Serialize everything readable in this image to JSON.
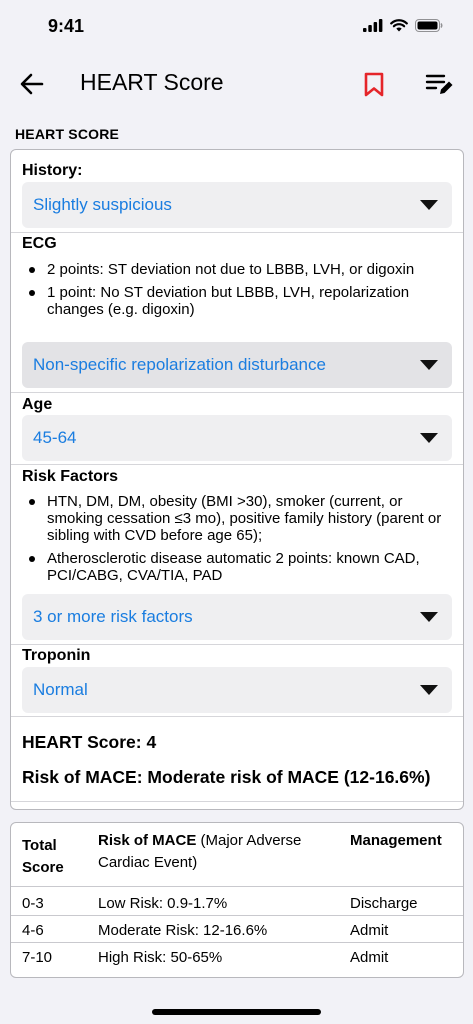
{
  "status_bar": {
    "time": "9:41"
  },
  "nav": {
    "title": "HEART Score"
  },
  "section_title": "HEART SCORE",
  "history": {
    "label": "History:",
    "value": "Slightly suspicious"
  },
  "ecg": {
    "label": "ECG",
    "bullets": [
      "2 points: ST deviation not due to LBBB, LVH, or digoxin",
      "1 point: No ST deviation but LBBB, LVH, repolarization changes (e.g. digoxin)"
    ],
    "value": "Non-specific repolarization disturbance"
  },
  "age": {
    "label": "Age",
    "value": "45-64"
  },
  "risk_factors": {
    "label": "Risk Factors",
    "bullets": [
      "HTN, DM, DM, obesity (BMI >30), smoker (current, or smoking cessation ≤3 mo), positive family history (parent or sibling with CVD before age 65);",
      "Atherosclerotic disease automatic 2 points: known CAD, PCI/CABG, CVA/TIA, PAD"
    ],
    "value": "3 or more risk factors"
  },
  "troponin": {
    "label": "Troponin",
    "value": "Normal"
  },
  "result": {
    "score": "HEART Score: 4",
    "risk": "Risk of MACE: Moderate risk of MACE (12-16.6%)"
  },
  "table": {
    "col1": "Total Score",
    "col2_bold": "Risk of MACE",
    "col2_rest": " (Major Adverse Cardiac Event)",
    "col3": "Management",
    "rows": [
      {
        "score": "0-3",
        "risk": "Low Risk: 0.9-1.7%",
        "mgmt": "Discharge"
      },
      {
        "score": "4-6",
        "risk": "Moderate Risk: 12-16.6%",
        "mgmt": "Admit"
      },
      {
        "score": "7-10",
        "risk": "High Risk: 50-65%",
        "mgmt": "Admit"
      }
    ]
  },
  "colors": {
    "accent": "#1a7de0",
    "bookmark": "#e5252a",
    "background": "#f2f2f7"
  },
  "icons": [
    "back-arrow-icon",
    "bookmark-icon",
    "notes-edit-icon",
    "signal-icon",
    "wifi-icon",
    "battery-icon"
  ]
}
